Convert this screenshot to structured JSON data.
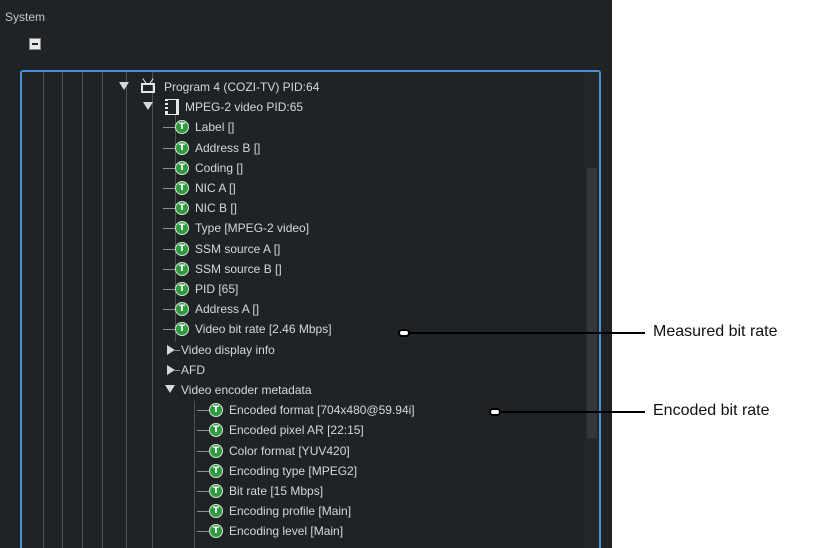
{
  "panel": {
    "title": "System"
  },
  "tree": {
    "program": {
      "label": "Program 4 (COZI-TV) PID:64"
    },
    "video": {
      "label": "MPEG-2 video PID:65"
    },
    "video_props": [
      "Label []",
      "Address B []",
      "Coding []",
      "NIC A []",
      "NIC B []",
      "Type [MPEG-2 video]",
      "SSM source A []",
      "SSM source B []",
      "PID [65]",
      "Address A []",
      "Video bit rate [2.46 Mbps]"
    ],
    "collapsed_groups": [
      "Video display info",
      "AFD"
    ],
    "encoder_group": {
      "label": "Video encoder metadata"
    },
    "encoder_props": [
      "Encoded format [704x480@59.94i]",
      "Encoded pixel AR [22:15]",
      "Color format [YUV420]",
      "Encoding type [MPEG2]",
      "Bit rate [15 Mbps]",
      "Encoding profile [Main]",
      "Encoding level [Main]"
    ]
  },
  "callouts": {
    "measured": "Measured bit rate",
    "encoded": "Encoded bit rate"
  },
  "colors": {
    "panel_bg": "#1f2326",
    "frame_border": "#4a90d6",
    "text_badge": "#2f9a3f"
  }
}
